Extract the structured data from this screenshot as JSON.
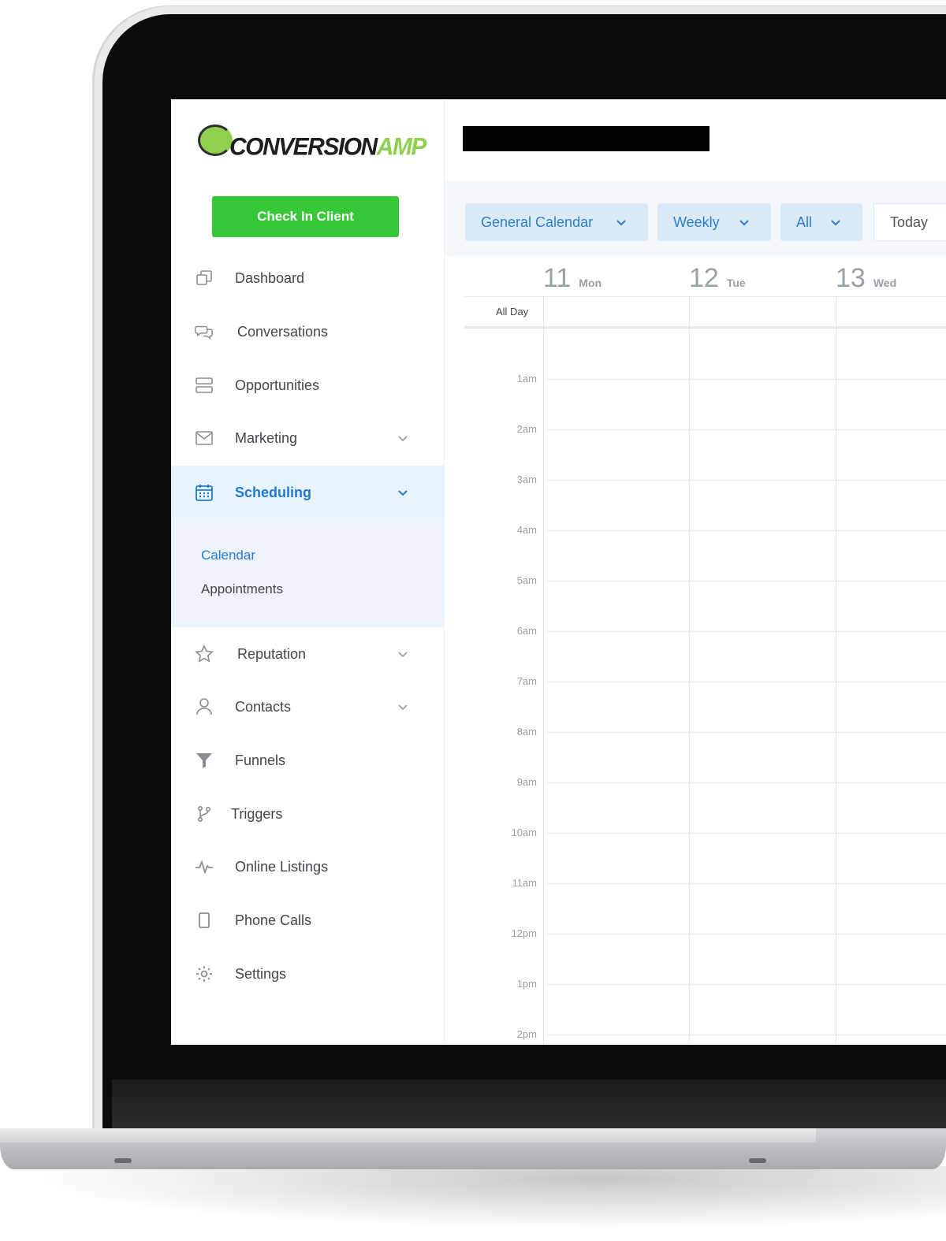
{
  "brand": {
    "logo_main": "CONVERSION",
    "logo_accent": "AMP"
  },
  "sidebar": {
    "checkin_label": "Check In Client",
    "items": [
      {
        "label": "Dashboard",
        "icon": "copy-icon"
      },
      {
        "label": "Conversations",
        "icon": "chat-bubbles-icon"
      },
      {
        "label": "Opportunities",
        "icon": "stack-icon"
      },
      {
        "label": "Marketing",
        "icon": "mail-icon"
      },
      {
        "label": "Scheduling",
        "icon": "calendar-icon"
      },
      {
        "label": "Reputation",
        "icon": "star-icon"
      },
      {
        "label": "Contacts",
        "icon": "user-icon"
      },
      {
        "label": "Funnels",
        "icon": "funnel-icon"
      },
      {
        "label": "Triggers",
        "icon": "branch-icon"
      },
      {
        "label": "Online Listings",
        "icon": "pulse-icon"
      },
      {
        "label": "Phone Calls",
        "icon": "phone-icon"
      },
      {
        "label": "Settings",
        "icon": "gear-icon"
      }
    ],
    "submenu": [
      {
        "label": "Calendar"
      },
      {
        "label": "Appointments"
      }
    ]
  },
  "toolbar": {
    "calendar_select": "General Calendar",
    "view_select": "Weekly",
    "filter_select": "All",
    "today_label": "Today"
  },
  "calendar": {
    "days": [
      {
        "num": "11",
        "name": "Mon"
      },
      {
        "num": "12",
        "name": "Tue"
      },
      {
        "num": "13",
        "name": "Wed"
      }
    ],
    "all_day_label": "All Day",
    "hours": [
      "1am",
      "2am",
      "3am",
      "4am",
      "5am",
      "6am",
      "7am",
      "8am",
      "9am",
      "10am",
      "11am",
      "12pm",
      "1pm",
      "2pm"
    ]
  },
  "colors": {
    "accent": "#1f7ad6",
    "checkin_green": "#37c837",
    "logo_green": "#8fd14f"
  }
}
